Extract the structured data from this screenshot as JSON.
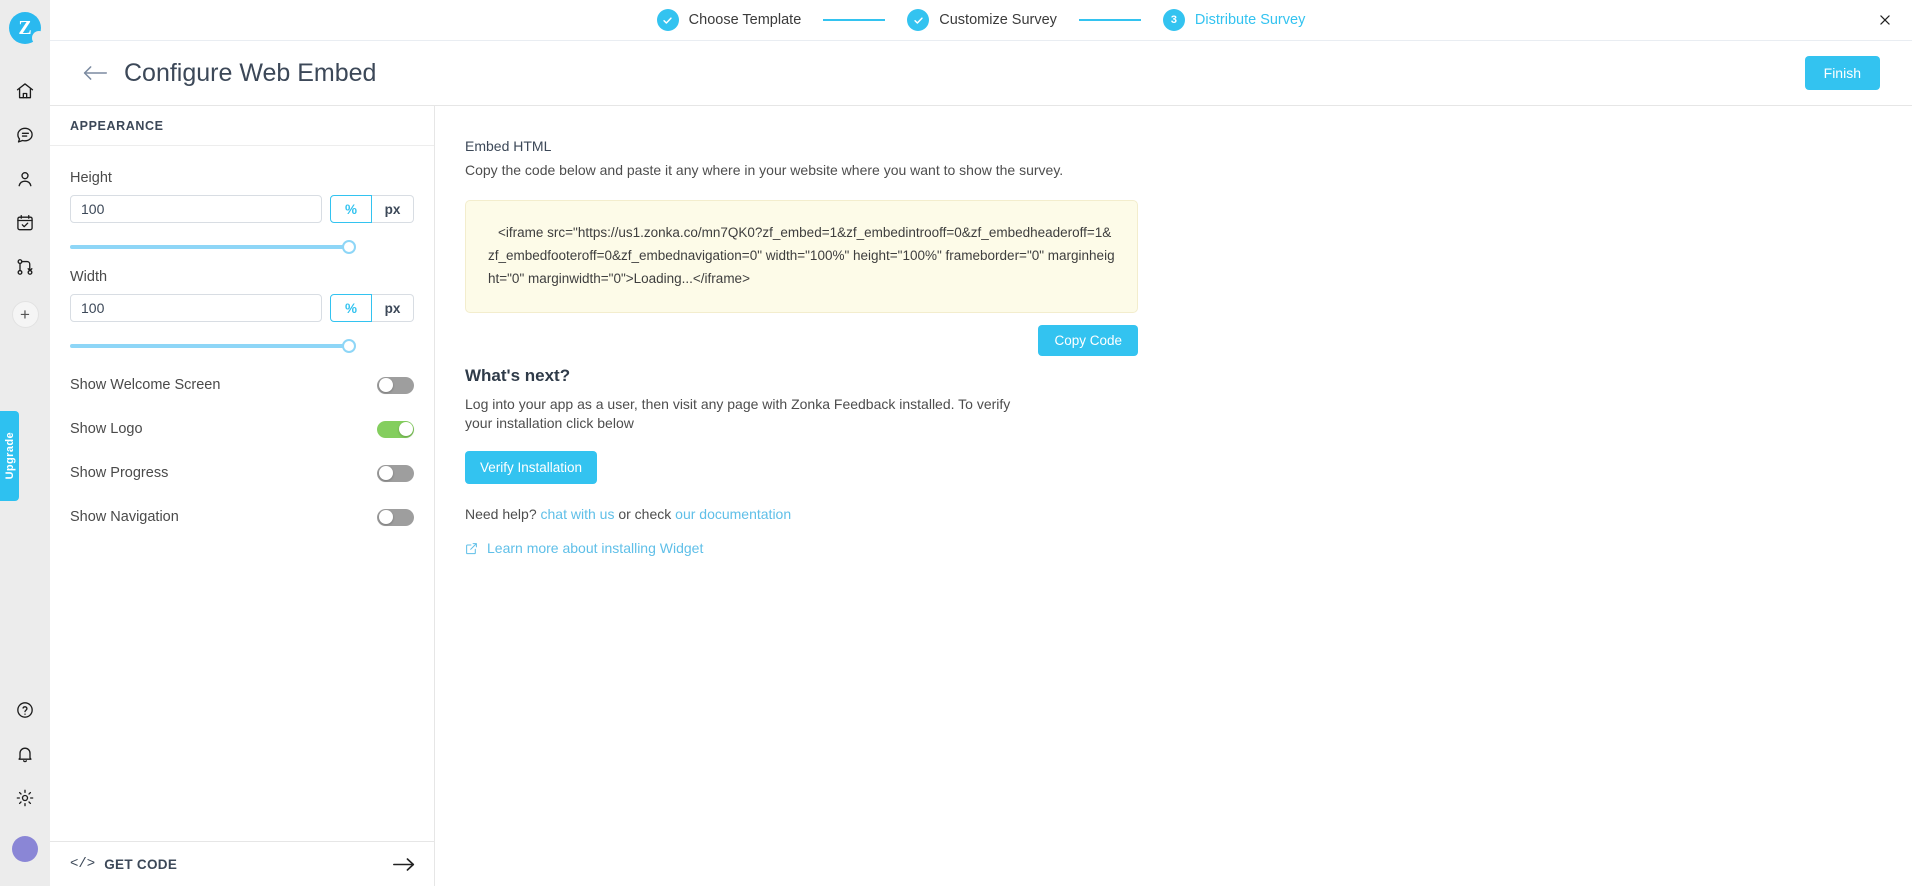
{
  "rail": {
    "logo_letter": "Z",
    "icons": [
      {
        "name": "home-icon",
        "label": "Home"
      },
      {
        "name": "feedback-icon",
        "label": "Feedback"
      },
      {
        "name": "contacts-icon",
        "label": "Contacts"
      },
      {
        "name": "surveys-icon",
        "label": "Surveys"
      },
      {
        "name": "workflows-icon",
        "label": "Workflows"
      }
    ],
    "add_label": "+",
    "bottom_icons": [
      {
        "name": "help-icon",
        "label": "Help"
      },
      {
        "name": "notifications-icon",
        "label": "Notifications"
      },
      {
        "name": "settings-icon",
        "label": "Settings"
      }
    ],
    "upgrade_label": "Upgrade"
  },
  "stepper": {
    "steps": [
      {
        "label": "Choose Template",
        "state": "complete",
        "marker": "check"
      },
      {
        "label": "Customize Survey",
        "state": "complete",
        "marker": "check"
      },
      {
        "label": "Distribute Survey",
        "state": "active",
        "marker": "3"
      }
    ],
    "close_label": "✕"
  },
  "header": {
    "title": "Configure Web Embed",
    "back_label": "←",
    "finish_label": "Finish"
  },
  "panel": {
    "section_title": "APPEARANCE",
    "height": {
      "label": "Height",
      "value": "100",
      "placeholder": "100",
      "unit_percent": "%",
      "unit_px": "px",
      "selected_unit": "%",
      "slider_value": 100
    },
    "width": {
      "label": "Width",
      "value": "100",
      "placeholder": "100",
      "unit_percent": "%",
      "unit_px": "px",
      "selected_unit": "%",
      "slider_value": 100
    },
    "toggles": [
      {
        "label": "Show Welcome Screen",
        "on": false
      },
      {
        "label": "Show Logo",
        "on": true
      },
      {
        "label": "Show Progress",
        "on": false
      },
      {
        "label": "Show Navigation",
        "on": false
      }
    ],
    "footer": {
      "label": "GET CODE",
      "code_glyph": "</>",
      "arrow": "→"
    }
  },
  "main": {
    "embed_title": "Embed HTML",
    "embed_subtitle": "Copy the code below and paste it any where in your website where you want to show the survey.",
    "embed_code": "<iframe src=\"https://us1.zonka.co/mn7QK0?zf_embed=1&zf_embedintrooff=0&zf_embedheaderoff=1&zf_embedfooteroff=0&zf_embednavigation=0\" width=\"100%\" height=\"100%\" frameborder=\"0\" marginheight=\"0\" marginwidth=\"0\">Loading...</iframe>",
    "copy_label": "Copy Code",
    "whats_next_title": "What's next?",
    "whats_next_desc": "Log into your app as a user, then visit any page with Zonka Feedback installed. To verify your installation click below",
    "verify_label": "Verify Installation",
    "help_prefix": "Need help?",
    "help_chat_link": "chat with us",
    "help_middle": "or check",
    "help_doc_link": "our documentation",
    "learn_more_label": "Learn more about installing Widget"
  },
  "colors": {
    "accent": "#33c3f0",
    "toggle_on": "#84ce5e",
    "toggle_off": "#9e9e9e",
    "code_bg": "#fdfbe8",
    "code_border": "#f3edcd",
    "rail_bg": "#ececec",
    "avatar": "#8a86d6"
  }
}
